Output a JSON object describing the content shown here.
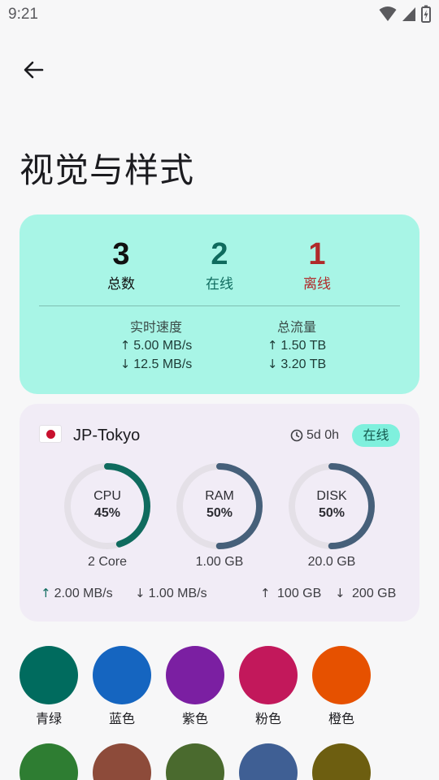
{
  "status_bar": {
    "time": "9:21"
  },
  "page": {
    "title": "视觉与样式"
  },
  "summary": {
    "total": {
      "value": "3",
      "label": "总数"
    },
    "online": {
      "value": "2",
      "label": "在线"
    },
    "offline": {
      "value": "1",
      "label": "离线"
    },
    "speed": {
      "title": "实时速度",
      "up": "5.00 MB/s",
      "down": "12.5 MB/s"
    },
    "traffic": {
      "title": "总流量",
      "up": "1.50 TB",
      "down": "3.20 TB"
    }
  },
  "server": {
    "name": "JP-Tokyo",
    "uptime": "5d 0h",
    "status": "在线",
    "cpu": {
      "label": "CPU",
      "percent": 45,
      "display": "45%",
      "sub": "2 Core"
    },
    "ram": {
      "label": "RAM",
      "percent": 50,
      "display": "50%",
      "sub": "1.00 GB"
    },
    "disk": {
      "label": "DISK",
      "percent": 50,
      "display": "50%",
      "sub": "20.0 GB"
    },
    "net_up": "2.00 MB/s",
    "net_down": "1.00 MB/s",
    "traffic_up": "100 GB",
    "traffic_down": "200 GB"
  },
  "colors": {
    "teal_accent": "#0f6b5e",
    "gauge_blue": "#46607a",
    "card_mint": "#a8f5e6",
    "card_lavender": "#f1ecf6",
    "offline_red": "#b02a2a"
  },
  "swatches": [
    {
      "label": "青绿",
      "color": "#006b5e"
    },
    {
      "label": "蓝色",
      "color": "#1565c0"
    },
    {
      "label": "紫色",
      "color": "#7b1fa2"
    },
    {
      "label": "粉色",
      "color": "#c2185b"
    },
    {
      "label": "橙色",
      "color": "#e65100"
    },
    {
      "label": "",
      "color": "#2e7d32"
    },
    {
      "label": "",
      "color": "#8d4b3a"
    },
    {
      "label": "",
      "color": "#4a6a2e"
    },
    {
      "label": "",
      "color": "#3f5f94"
    },
    {
      "label": "",
      "color": "#6d5e10"
    }
  ]
}
